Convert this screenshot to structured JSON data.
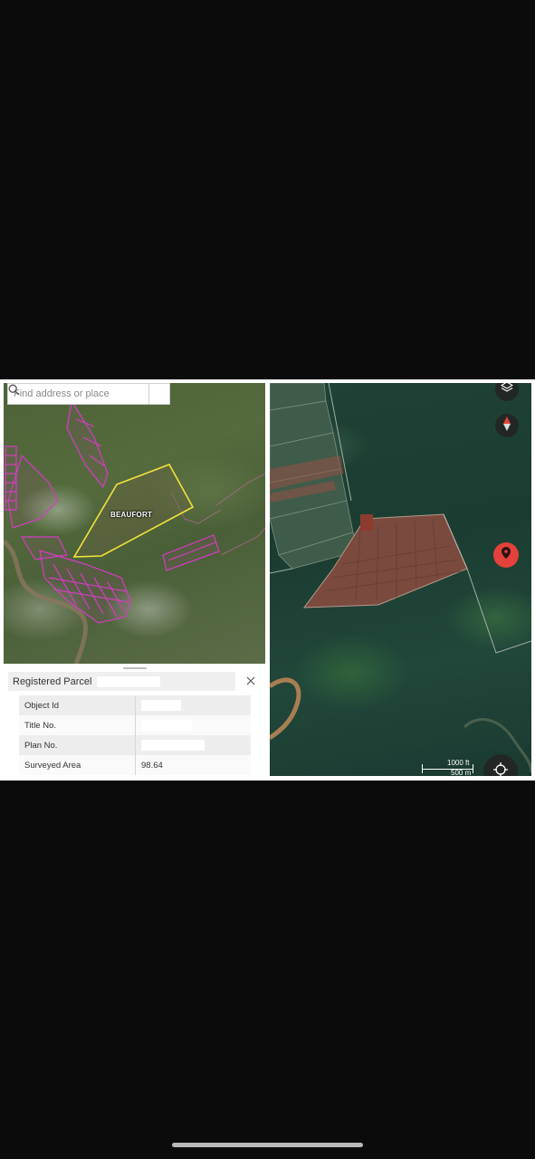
{
  "left_panel": {
    "search": {
      "placeholder": "Find address or place"
    },
    "map": {
      "parcel_label": "BEAUFORT"
    },
    "popup": {
      "title": "Registered Parcel",
      "rows": [
        {
          "label": "Object Id",
          "value": ""
        },
        {
          "label": "Title No.",
          "value": ""
        },
        {
          "label": "Plan No.",
          "value": ""
        },
        {
          "label": "Surveyed Area",
          "value": "98.64"
        }
      ]
    }
  },
  "right_panel": {
    "controls": {
      "layers_icon": "layers-icon",
      "compass_icon": "compass-icon",
      "location_marker_icon": "location-pin-icon",
      "my_location_icon": "crosshair-icon"
    },
    "scale": {
      "top_label": "1000 ft",
      "bottom_label": "500 m"
    }
  },
  "colors": {
    "parcel_outline": "#f2e33c",
    "cadastral_lines": "#d63cc4",
    "marker": "#e3413b"
  }
}
